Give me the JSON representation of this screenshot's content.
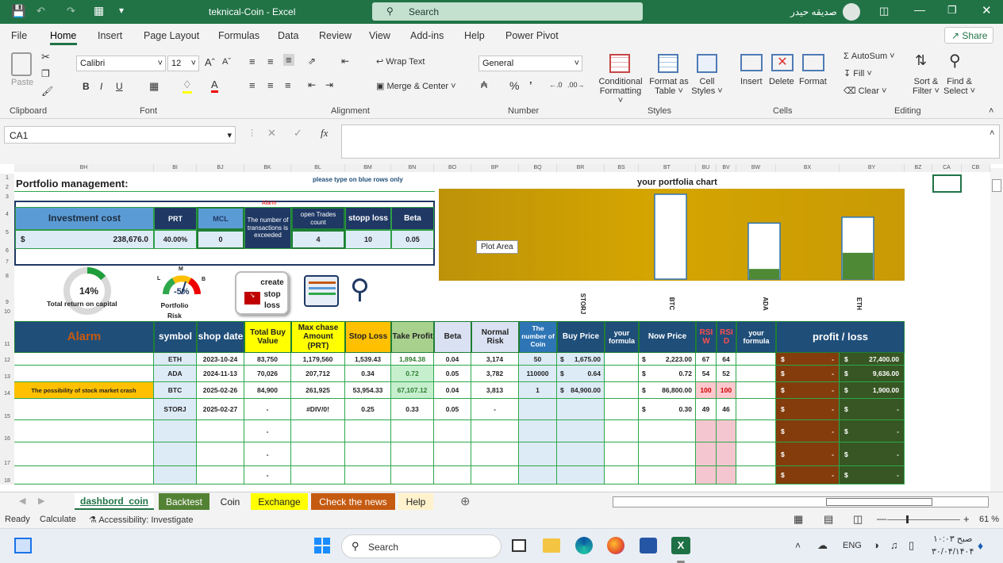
{
  "app": {
    "title": "teknical-Coin  -  Excel",
    "search_placeholder": "Search",
    "user": "صديقه حيدر",
    "share": "Share"
  },
  "menu": [
    "File",
    "Home",
    "Insert",
    "Page Layout",
    "Formulas",
    "Data",
    "Review",
    "View",
    "Add-ins",
    "Help",
    "Power Pivot"
  ],
  "ribbon": {
    "groups": [
      "Clipboard",
      "Font",
      "Alignment",
      "Number",
      "Styles",
      "Cells",
      "Editing"
    ],
    "paste": "Paste",
    "font_name": "Calibri",
    "font_size": "12",
    "wrap_text": "Wrap Text",
    "merge_center": "Merge & Center",
    "number_format": "General",
    "cond_format": "Conditional",
    "cond_format2": "Formatting",
    "format_table": "Format as",
    "format_table2": "Table",
    "cell_styles": "Cell",
    "cell_styles2": "Styles",
    "insert": "Insert",
    "delete": "Delete",
    "format": "Format",
    "autosum": "AutoSum",
    "fill": "Fill",
    "clear": "Clear",
    "sort_filter": "Sort &",
    "sort_filter2": "Filter",
    "find_select": "Find &",
    "find_select2": "Select"
  },
  "formula": {
    "namebox": "CA1",
    "content": ""
  },
  "columns": [
    "BH",
    "BI",
    "BJ",
    "BK",
    "BL",
    "BM",
    "BN",
    "BO",
    "BP",
    "BQ",
    "BR",
    "BS",
    "BT",
    "BU",
    "BV",
    "BW",
    "BX",
    "BY",
    "BZ",
    "CA",
    "CB"
  ],
  "rows": [
    "1",
    "2",
    "3",
    "4",
    "5",
    "6",
    "7",
    "8",
    "9",
    "10",
    "11",
    "12",
    "13",
    "14",
    "15",
    "16",
    "17",
    "18"
  ],
  "sheet": {
    "title": "Portfolio management:",
    "hint": "please type on blue rows only",
    "chart_title": "your portfolia chart",
    "alarm_small": "Alarm",
    "summary_headers": [
      "Investment cost",
      "PRT",
      "MCL",
      "The number of transactions is exceeded",
      "open Trades count",
      "stopp loss",
      "Beta"
    ],
    "summary_values": [
      "$",
      "238,676.0",
      "40.00%",
      "0",
      "",
      "4",
      "10",
      "0.05"
    ],
    "gauge1": {
      "value": "14%",
      "label": "Total return on capital"
    },
    "gauge2": {
      "value": "-5%",
      "label": "Portfolio Risk",
      "l": "L",
      "m": "M",
      "b": "B"
    },
    "create_button": "create stop loss",
    "table_headers": [
      "Alarm",
      "symbol",
      "shop date",
      "Total Buy Value",
      "Max chase Amount (PRT)",
      "Stop Loss",
      "Take Profit",
      "Beta",
      "Normal Risk",
      "The number of Coin",
      "Buy Price",
      "your formula",
      "Now Price",
      "RSI W",
      "RSI D",
      "your formula",
      "profit / loss"
    ],
    "rows": [
      {
        "alarm": "",
        "symbol": "ETH",
        "date": "2023-10-24",
        "total": "83,750",
        "max": "1,179,560",
        "sl": "1,539.43",
        "tp": "1,894.38",
        "beta": "0.04",
        "risk": "3,174",
        "coin": "50",
        "buy_cur": "$",
        "buy": "1,675.00",
        "now_cur": "$",
        "now": "2,223.00",
        "rsiw": "67",
        "rsid": "64",
        "pl1c": "$",
        "pl1": "-",
        "pl2c": "$",
        "pl2": "27,400.00"
      },
      {
        "alarm": "",
        "symbol": "ADA",
        "date": "2024-11-13",
        "total": "70,026",
        "max": "207,712",
        "sl": "0.34",
        "tp": "0.72",
        "beta": "0.05",
        "risk": "3,782",
        "coin": "110000",
        "buy_cur": "$",
        "buy": "0.64",
        "now_cur": "$",
        "now": "0.72",
        "rsiw": "54",
        "rsid": "52",
        "pl1c": "$",
        "pl1": "-",
        "pl2c": "$",
        "pl2": "9,636.00"
      },
      {
        "alarm": "The possibility of stock market crash",
        "symbol": "BTC",
        "date": "2025-02-26",
        "total": "84,900",
        "max": "261,925",
        "sl": "53,954.33",
        "tp": "67,107.12",
        "beta": "0.04",
        "risk": "3,813",
        "coin": "1",
        "buy_cur": "$",
        "buy": "84,900.00",
        "now_cur": "$",
        "now": "86,800.00",
        "rsiw": "100",
        "rsid": "100",
        "pl1c": "$",
        "pl1": "-",
        "pl2c": "$",
        "pl2": "1,900.00"
      },
      {
        "alarm": "",
        "symbol": "STORJ",
        "date": "2025-02-27",
        "total": "-",
        "max": "#DIV/0!",
        "sl": "0.25",
        "tp": "0.33",
        "beta": "0.05",
        "risk": "-",
        "coin": "",
        "buy_cur": "",
        "buy": "",
        "now_cur": "$",
        "now": "0.30",
        "rsiw": "49",
        "rsid": "46",
        "pl1c": "$",
        "pl1": "-",
        "pl2c": "$",
        "pl2": "-"
      },
      {
        "alarm": "",
        "symbol": "",
        "date": "",
        "total": "-",
        "max": "",
        "sl": "",
        "tp": "",
        "beta": "",
        "risk": "",
        "coin": "",
        "buy_cur": "",
        "buy": "",
        "now_cur": "",
        "now": "",
        "rsiw": "",
        "rsid": "",
        "pl1c": "$",
        "pl1": "-",
        "pl2c": "$",
        "pl2": "-"
      },
      {
        "alarm": "",
        "symbol": "",
        "date": "",
        "total": "-",
        "max": "",
        "sl": "",
        "tp": "",
        "beta": "",
        "risk": "",
        "coin": "",
        "buy_cur": "",
        "buy": "",
        "now_cur": "",
        "now": "",
        "rsiw": "",
        "rsid": "",
        "pl1c": "$",
        "pl1": "-",
        "pl2c": "$",
        "pl2": "-"
      },
      {
        "alarm": "",
        "symbol": "",
        "date": "",
        "total": "-",
        "max": "",
        "sl": "",
        "tp": "",
        "beta": "",
        "risk": "",
        "coin": "",
        "buy_cur": "",
        "buy": "",
        "now_cur": "",
        "now": "",
        "rsiw": "",
        "rsid": "",
        "pl1c": "$",
        "pl1": "-",
        "pl2c": "$",
        "pl2": "-"
      }
    ],
    "plot_area_tooltip": "Plot Area"
  },
  "chart_data": {
    "type": "bar",
    "title": "your portfolia chart",
    "categories": [
      "STORJ",
      "BTC",
      "ADA",
      "ETH"
    ],
    "series": [
      {
        "values": [
          0,
          1.0,
          0.66,
          0.73
        ]
      },
      {
        "values": [
          0,
          0,
          0.12,
          0.31
        ]
      }
    ],
    "ylim": [
      0,
      1
    ]
  },
  "sheet_tabs": [
    {
      "label": "dashbord_coin",
      "color": "#ffffff",
      "text": "#217346"
    },
    {
      "label": "Backtest",
      "color": "#548235",
      "text": "#ffffff"
    },
    {
      "label": "Coin",
      "color": "#f3f3f3",
      "text": "#222222"
    },
    {
      "label": "Exchange",
      "color": "#ffff00",
      "text": "#222222"
    },
    {
      "label": "Check the news",
      "color": "#c55a11",
      "text": "#ffffff"
    },
    {
      "label": "Help",
      "color": "#fff2cc",
      "text": "#222222"
    }
  ],
  "status": {
    "ready": "Ready",
    "calculate": "Calculate",
    "accessibility": "Accessibility: Investigate",
    "zoom": "61 %"
  },
  "taskbar": {
    "search": "Search",
    "lang": "ENG",
    "time": "۱۰:۰۳ صبح",
    "date": "۳۰/۰۴/۱۴۰۴"
  }
}
